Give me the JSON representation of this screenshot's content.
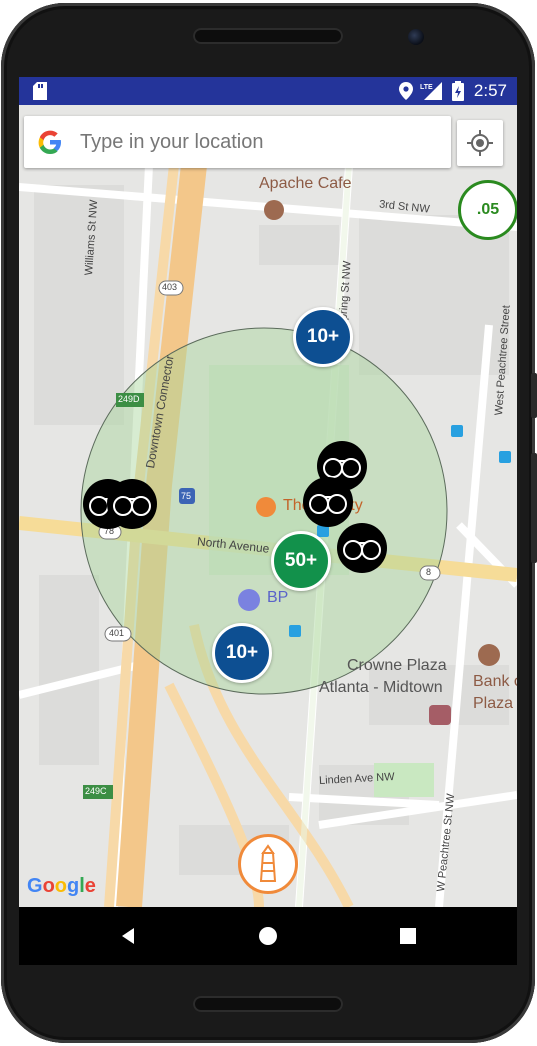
{
  "status_bar": {
    "time": "2:57",
    "network": "LTE"
  },
  "search": {
    "placeholder": "Type in your location"
  },
  "radius_badge": {
    "label": ".05",
    "color": "#2a8a1f"
  },
  "clusters": [
    {
      "label": "10+",
      "color": "#0d4f92"
    },
    {
      "label": "50+",
      "color": "#12914b"
    },
    {
      "label": "10+",
      "color": "#0d4f92"
    }
  ],
  "map_labels": {
    "apache_cafe": "Apache Cafe",
    "third_st": "3rd St NW",
    "williams_st": "Williams St NW",
    "spring_st": "Spring St NW",
    "west_peachtree": "West Peachtree Street",
    "downtown_connector": "Downtown Connector",
    "north_avenue": "North Avenue",
    "the_varsity": "The Varsity",
    "bp": "BP",
    "crowne_plaza_1": "Crowne Plaza",
    "crowne_plaza_2": "Atlanta - Midtown",
    "bank_1": "Bank of",
    "bank_2": "Plaza",
    "linden_ave": "Linden Ave NW",
    "w_peachtree_st": "W Peachtree St NW",
    "route_403": "403",
    "route_249d": "249D",
    "route_75": "75",
    "route_78": "78",
    "route_8": "8",
    "route_401": "401",
    "route_249c": "249C"
  },
  "google_logo": [
    "G",
    "o",
    "o",
    "g",
    "l",
    "e"
  ],
  "colors": {
    "status_bar": "#24349a",
    "accent_orange": "#f08a3a",
    "search_radius": "#2a8a1f"
  },
  "icons": [
    "sd-card-icon",
    "location-pin-icon",
    "signal-icon",
    "battery-icon",
    "google-g-icon",
    "my-location-icon",
    "handcuffs-icon",
    "lighthouse-icon",
    "back-icon",
    "home-icon",
    "recents-icon"
  ]
}
